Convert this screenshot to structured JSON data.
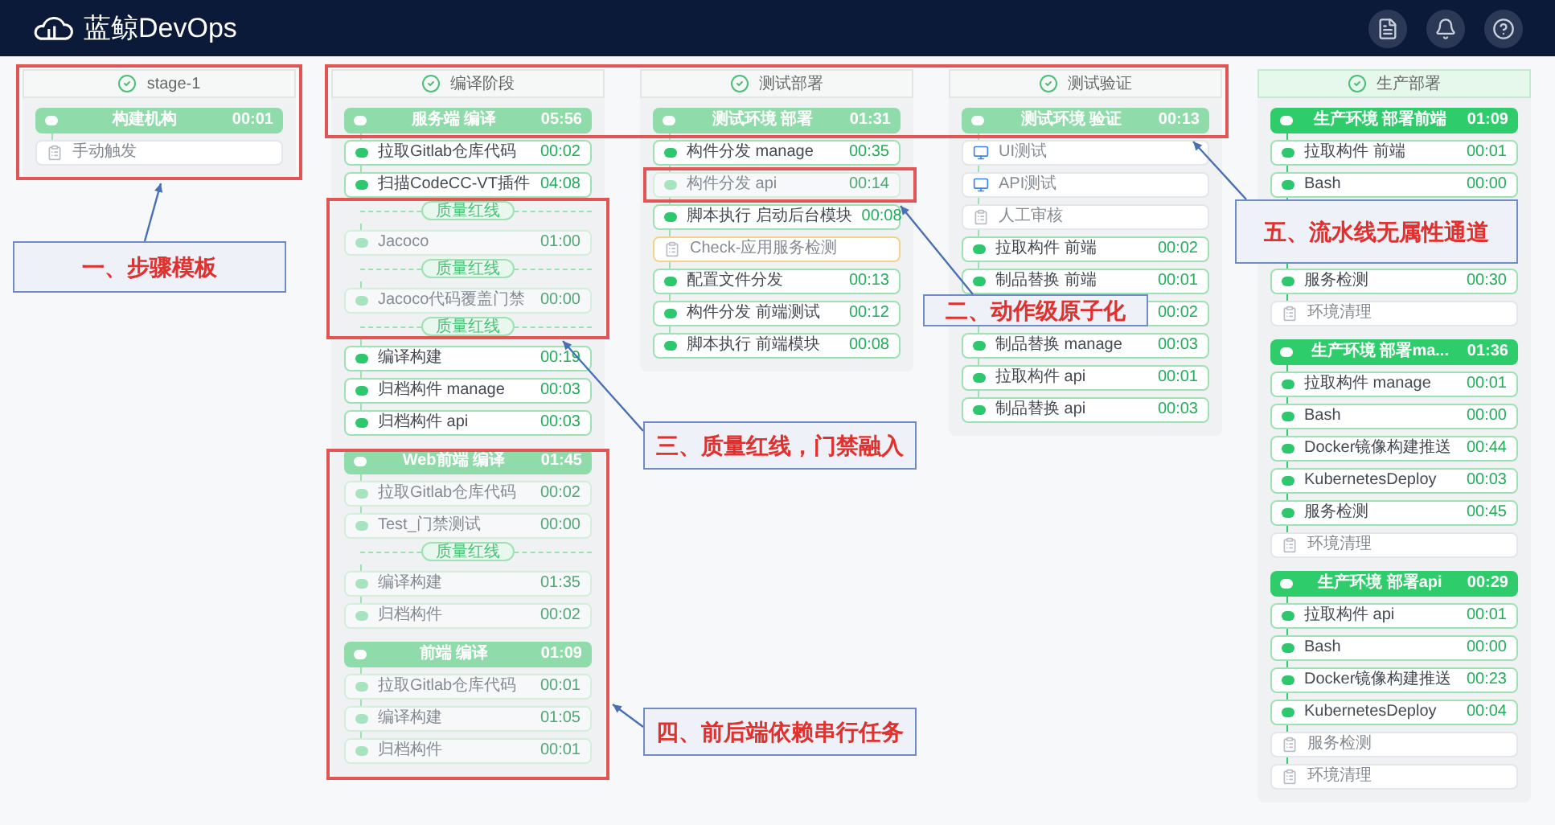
{
  "app": {
    "title": "蓝鲸DevOps"
  },
  "stages": [
    {
      "name": "stage-1",
      "active": false,
      "jobs": [
        {
          "name": "构建机构",
          "time": "00:01",
          "active": false,
          "steps": [
            {
              "kind": "pending",
              "name": "手动触发"
            }
          ]
        }
      ]
    },
    {
      "name": "编译阶段",
      "active": false,
      "jobs": [
        {
          "name": "服务端 编译",
          "time": "05:56",
          "active": false,
          "steps": [
            {
              "kind": "task",
              "name": "拉取Gitlab仓库代码",
              "time": "00:02",
              "disabled": false
            },
            {
              "kind": "task",
              "name": "扫描CodeCC-VT插件",
              "time": "04:08",
              "disabled": false
            },
            {
              "kind": "gate",
              "label": "质量红线"
            },
            {
              "kind": "task",
              "name": "Jacoco",
              "time": "01:00",
              "disabled": true
            },
            {
              "kind": "gate",
              "label": "质量红线"
            },
            {
              "kind": "task",
              "name": "Jacoco代码覆盖门禁",
              "time": "00:00",
              "disabled": true
            },
            {
              "kind": "gate",
              "label": "质量红线"
            },
            {
              "kind": "task",
              "name": "编译构建",
              "time": "00:19",
              "disabled": false
            },
            {
              "kind": "task",
              "name": "归档构件 manage",
              "time": "00:03",
              "disabled": false
            },
            {
              "kind": "task",
              "name": "归档构件 api",
              "time": "00:03",
              "disabled": false
            }
          ]
        },
        {
          "name": "Web前端 编译",
          "time": "01:45",
          "active": false,
          "steps": [
            {
              "kind": "task",
              "name": "拉取Gitlab仓库代码",
              "time": "00:02",
              "disabled": true
            },
            {
              "kind": "task",
              "name": "Test_门禁测试",
              "time": "00:00",
              "disabled": true
            },
            {
              "kind": "gate",
              "label": "质量红线"
            },
            {
              "kind": "task",
              "name": "编译构建",
              "time": "01:35",
              "disabled": true
            },
            {
              "kind": "task",
              "name": "归档构件",
              "time": "00:02",
              "disabled": true
            }
          ]
        },
        {
          "name": "前端 编译",
          "time": "01:09",
          "active": false,
          "steps": [
            {
              "kind": "task",
              "name": "拉取Gitlab仓库代码",
              "time": "00:01",
              "disabled": true
            },
            {
              "kind": "task",
              "name": "编译构建",
              "time": "01:05",
              "disabled": true
            },
            {
              "kind": "task",
              "name": "归档构件",
              "time": "00:01",
              "disabled": true
            }
          ]
        }
      ]
    },
    {
      "name": "测试部署",
      "active": false,
      "jobs": [
        {
          "name": "测试环境 部署",
          "time": "01:31",
          "active": false,
          "steps": [
            {
              "kind": "task",
              "name": "构件分发 manage",
              "time": "00:35",
              "disabled": false
            },
            {
              "kind": "task",
              "name": "构件分发 api",
              "time": "00:14",
              "disabled": true
            },
            {
              "kind": "task",
              "name": "脚本执行 启动后台模块",
              "time": "00:08",
              "disabled": false
            },
            {
              "kind": "check",
              "name": "Check-应用服务检测"
            },
            {
              "kind": "task",
              "name": "配置文件分发",
              "time": "00:13",
              "disabled": false
            },
            {
              "kind": "task",
              "name": "构件分发 前端测试",
              "time": "00:12",
              "disabled": false
            },
            {
              "kind": "task",
              "name": "脚本执行 前端模块",
              "time": "00:08",
              "disabled": false
            }
          ]
        }
      ]
    },
    {
      "name": "测试验证",
      "active": false,
      "jobs": [
        {
          "name": "测试环境 验证",
          "time": "00:13",
          "active": false,
          "steps": [
            {
              "kind": "test",
              "name": "UI测试"
            },
            {
              "kind": "test",
              "name": "API测试"
            },
            {
              "kind": "pending",
              "name": "人工审核"
            },
            {
              "kind": "task",
              "name": "拉取构件 前端",
              "time": "00:02",
              "disabled": false
            },
            {
              "kind": "task",
              "name": "制品替换 前端",
              "time": "00:01",
              "disabled": false
            },
            {
              "kind": "task",
              "time": "00:02",
              "disabled": false
            },
            {
              "kind": "task",
              "name": "制品替换 manage",
              "time": "00:03",
              "disabled": false
            },
            {
              "kind": "task",
              "name": "拉取构件 api",
              "time": "00:01",
              "disabled": false
            },
            {
              "kind": "task",
              "name": "制品替换 api",
              "time": "00:03",
              "disabled": false
            }
          ]
        }
      ]
    },
    {
      "name": "生产部署",
      "active": true,
      "jobs": [
        {
          "name": "生产环境 部署前端",
          "time": "01:09",
          "active": true,
          "steps": [
            {
              "kind": "task",
              "name": "拉取构件 前端",
              "time": "00:01",
              "disabled": false
            },
            {
              "kind": "task",
              "name": "Bash",
              "time": "00:00",
              "disabled": false
            },
            {
              "kind": "task"
            },
            {
              "kind": "task"
            },
            {
              "kind": "task",
              "name": "服务检测",
              "time": "00:30",
              "disabled": false
            },
            {
              "kind": "pending",
              "name": "环境清理"
            }
          ]
        },
        {
          "name": "生产环境 部署ma...",
          "time": "01:36",
          "active": true,
          "steps": [
            {
              "kind": "task",
              "name": "拉取构件 manage",
              "time": "00:01",
              "disabled": false
            },
            {
              "kind": "task",
              "name": "Bash",
              "time": "00:00",
              "disabled": false
            },
            {
              "kind": "task",
              "name": "Docker镜像构建推送",
              "time": "00:44",
              "disabled": false
            },
            {
              "kind": "task",
              "name": "KubernetesDeploy",
              "time": "00:03",
              "disabled": false
            },
            {
              "kind": "task",
              "name": "服务检测",
              "time": "00:45",
              "disabled": false
            },
            {
              "kind": "pending",
              "name": "环境清理"
            }
          ]
        },
        {
          "name": "生产环境 部署api",
          "time": "00:29",
          "active": true,
          "steps": [
            {
              "kind": "task",
              "name": "拉取构件 api",
              "time": "00:01",
              "disabled": false
            },
            {
              "kind": "task",
              "name": "Bash",
              "time": "00:00",
              "disabled": false
            },
            {
              "kind": "task",
              "name": "Docker镜像构建推送",
              "time": "00:23",
              "disabled": false
            },
            {
              "kind": "task",
              "name": "KubernetesDeploy",
              "time": "00:04",
              "disabled": false
            },
            {
              "kind": "pending",
              "name": "服务检测"
            },
            {
              "kind": "pending",
              "name": "环境清理"
            }
          ]
        }
      ]
    }
  ],
  "callouts": [
    "一、步骤模板",
    "二、动作级原子化",
    "三、质量红线，门禁融入",
    "四、前后端依赖串行任务",
    "五、流水线无属性通道"
  ]
}
